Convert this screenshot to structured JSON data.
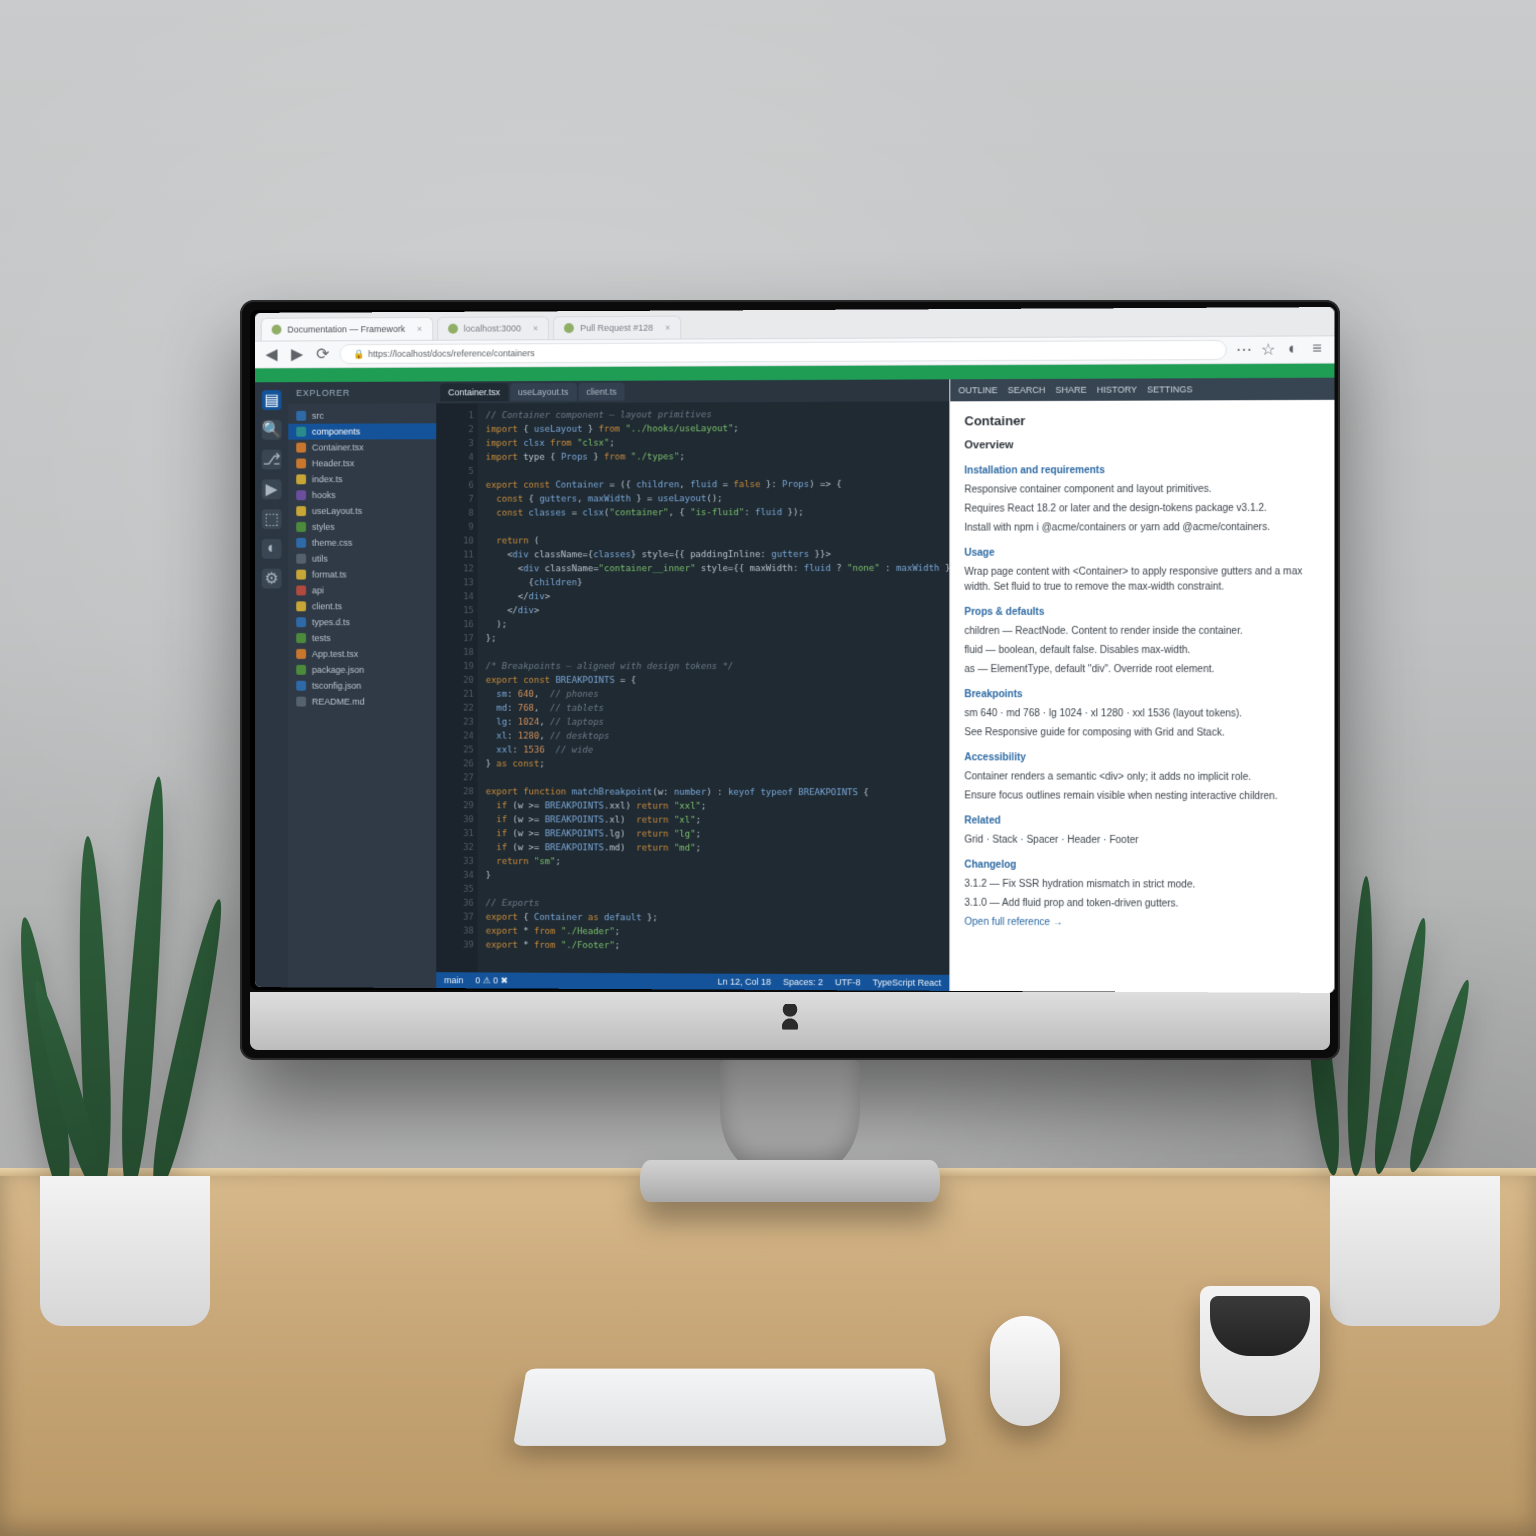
{
  "browser": {
    "tabs": [
      {
        "label": "Documentation — Framework",
        "active": true
      },
      {
        "label": "localhost:3000",
        "active": false
      },
      {
        "label": "Pull Request #128",
        "active": false
      }
    ],
    "url": "https://localhost/docs/reference/containers"
  },
  "activity": {
    "items": [
      "files",
      "search",
      "source-control",
      "debug",
      "extensions",
      "accounts",
      "settings"
    ]
  },
  "sidebar": {
    "title": "EXPLORER",
    "items": [
      {
        "name": "src",
        "color": "c-blue"
      },
      {
        "name": "components",
        "color": "c-teal",
        "sel": true
      },
      {
        "name": "Container.tsx",
        "color": "c-orange"
      },
      {
        "name": "Header.tsx",
        "color": "c-orange"
      },
      {
        "name": "index.ts",
        "color": "c-yellow"
      },
      {
        "name": "hooks",
        "color": "c-purple"
      },
      {
        "name": "useLayout.ts",
        "color": "c-yellow"
      },
      {
        "name": "styles",
        "color": "c-green"
      },
      {
        "name": "theme.css",
        "color": "c-blue"
      },
      {
        "name": "utils",
        "color": "c-gray"
      },
      {
        "name": "format.ts",
        "color": "c-yellow"
      },
      {
        "name": "api",
        "color": "c-red"
      },
      {
        "name": "client.ts",
        "color": "c-yellow"
      },
      {
        "name": "types.d.ts",
        "color": "c-blue"
      },
      {
        "name": "tests",
        "color": "c-green"
      },
      {
        "name": "App.test.tsx",
        "color": "c-orange"
      },
      {
        "name": "package.json",
        "color": "c-green"
      },
      {
        "name": "tsconfig.json",
        "color": "c-blue"
      },
      {
        "name": "README.md",
        "color": "c-gray"
      }
    ]
  },
  "editor": {
    "tabs": [
      {
        "label": "Container.tsx",
        "active": true
      },
      {
        "label": "useLayout.ts",
        "active": false
      },
      {
        "label": "client.ts",
        "active": false
      }
    ],
    "code": [
      [
        [
          "com",
          "// Container component — layout primitives"
        ]
      ],
      [
        [
          "kw",
          "import"
        ],
        [
          "op",
          " { "
        ],
        [
          "fn",
          "useLayout"
        ],
        [
          "op",
          " } "
        ],
        [
          "kw",
          "from"
        ],
        [
          "op",
          " "
        ],
        [
          "str",
          "\"../hooks/useLayout\""
        ],
        [
          "op",
          ";"
        ]
      ],
      [
        [
          "kw",
          "import"
        ],
        [
          "op",
          " "
        ],
        [
          "fn",
          "clsx"
        ],
        [
          "op",
          " "
        ],
        [
          "kw",
          "from"
        ],
        [
          "op",
          " "
        ],
        [
          "str",
          "\"clsx\""
        ],
        [
          "op",
          ";"
        ]
      ],
      [
        [
          "kw",
          "import"
        ],
        [
          "op",
          " type { "
        ],
        [
          "fn",
          "Props"
        ],
        [
          "op",
          " } "
        ],
        [
          "kw",
          "from"
        ],
        [
          "op",
          " "
        ],
        [
          "str",
          "\"./types\""
        ],
        [
          "op",
          ";"
        ]
      ],
      [],
      [
        [
          "kw",
          "export"
        ],
        [
          "op",
          " "
        ],
        [
          "kw",
          "const"
        ],
        [
          "op",
          " "
        ],
        [
          "fn",
          "Container"
        ],
        [
          "op",
          " = ({ "
        ],
        [
          "fn",
          "children"
        ],
        [
          "op",
          ", "
        ],
        [
          "fn",
          "fluid"
        ],
        [
          "op",
          " = "
        ],
        [
          "kw",
          "false"
        ],
        [
          "op",
          " }: "
        ],
        [
          "fn",
          "Props"
        ],
        [
          "op",
          ") => {"
        ]
      ],
      [
        [
          "op",
          "  "
        ],
        [
          "kw",
          "const"
        ],
        [
          "op",
          " { "
        ],
        [
          "fn",
          "gutters"
        ],
        [
          "op",
          ", "
        ],
        [
          "fn",
          "maxWidth"
        ],
        [
          "op",
          " } = "
        ],
        [
          "fn",
          "useLayout"
        ],
        [
          "op",
          "();"
        ]
      ],
      [
        [
          "op",
          "  "
        ],
        [
          "kw",
          "const"
        ],
        [
          "op",
          " "
        ],
        [
          "fn",
          "classes"
        ],
        [
          "op",
          " = "
        ],
        [
          "fn",
          "clsx"
        ],
        [
          "op",
          "("
        ],
        [
          "str",
          "\"container\""
        ],
        [
          "op",
          ", { "
        ],
        [
          "str",
          "\"is-fluid\""
        ],
        [
          "op",
          ": "
        ],
        [
          "fn",
          "fluid"
        ],
        [
          "op",
          " });"
        ]
      ],
      [],
      [
        [
          "op",
          "  "
        ],
        [
          "kw",
          "return"
        ],
        [
          "op",
          " ("
        ]
      ],
      [
        [
          "op",
          "    <"
        ],
        [
          "fn",
          "div"
        ],
        [
          "op",
          " className={"
        ],
        [
          "fn",
          "classes"
        ],
        [
          "op",
          "} style={{ paddingInline: "
        ],
        [
          "fn",
          "gutters"
        ],
        [
          "op",
          " }}>"
        ]
      ],
      [
        [
          "op",
          "      <"
        ],
        [
          "fn",
          "div"
        ],
        [
          "op",
          " className="
        ],
        [
          "str",
          "\"container__inner\""
        ],
        [
          "op",
          " style={{ maxWidth: "
        ],
        [
          "fn",
          "fluid"
        ],
        [
          "op",
          " ? "
        ],
        [
          "str",
          "\"none\""
        ],
        [
          "op",
          " : "
        ],
        [
          "fn",
          "maxWidth"
        ],
        [
          "op",
          " }}>"
        ]
      ],
      [
        [
          "op",
          "        {"
        ],
        [
          "fn",
          "children"
        ],
        [
          "op",
          "}"
        ]
      ],
      [
        [
          "op",
          "      </"
        ],
        [
          "fn",
          "div"
        ],
        [
          "op",
          ">"
        ]
      ],
      [
        [
          "op",
          "    </"
        ],
        [
          "fn",
          "div"
        ],
        [
          "op",
          ">"
        ]
      ],
      [
        [
          "op",
          "  );"
        ]
      ],
      [
        [
          "op",
          "};"
        ]
      ],
      [],
      [
        [
          "com",
          "/* Breakpoints — aligned with design tokens */"
        ]
      ],
      [
        [
          "kw",
          "export"
        ],
        [
          "op",
          " "
        ],
        [
          "kw",
          "const"
        ],
        [
          "op",
          " "
        ],
        [
          "fn",
          "BREAKPOINTS"
        ],
        [
          "op",
          " = {"
        ]
      ],
      [
        [
          "op",
          "  "
        ],
        [
          "fn",
          "sm"
        ],
        [
          "op",
          ": "
        ],
        [
          "num",
          "640"
        ],
        [
          "op",
          ",  "
        ],
        [
          "com",
          "// phones"
        ]
      ],
      [
        [
          "op",
          "  "
        ],
        [
          "fn",
          "md"
        ],
        [
          "op",
          ": "
        ],
        [
          "num",
          "768"
        ],
        [
          "op",
          ",  "
        ],
        [
          "com",
          "// tablets"
        ]
      ],
      [
        [
          "op",
          "  "
        ],
        [
          "fn",
          "lg"
        ],
        [
          "op",
          ": "
        ],
        [
          "num",
          "1024"
        ],
        [
          "op",
          ", "
        ],
        [
          "com",
          "// laptops"
        ]
      ],
      [
        [
          "op",
          "  "
        ],
        [
          "fn",
          "xl"
        ],
        [
          "op",
          ": "
        ],
        [
          "num",
          "1280"
        ],
        [
          "op",
          ", "
        ],
        [
          "com",
          "// desktops"
        ]
      ],
      [
        [
          "op",
          "  "
        ],
        [
          "fn",
          "xxl"
        ],
        [
          "op",
          ": "
        ],
        [
          "num",
          "1536"
        ],
        [
          "op",
          "  "
        ],
        [
          "com",
          "// wide"
        ]
      ],
      [
        [
          "op",
          "} "
        ],
        [
          "kw",
          "as const"
        ],
        [
          "op",
          ";"
        ]
      ],
      [],
      [
        [
          "kw",
          "export"
        ],
        [
          "op",
          " "
        ],
        [
          "kw",
          "function"
        ],
        [
          "op",
          " "
        ],
        [
          "fn",
          "matchBreakpoint"
        ],
        [
          "op",
          "(w: "
        ],
        [
          "fn",
          "number"
        ],
        [
          "op",
          ") : "
        ],
        [
          "fn",
          "keyof typeof"
        ],
        [
          "op",
          " "
        ],
        [
          "fn",
          "BREAKPOINTS"
        ],
        [
          "op",
          " {"
        ]
      ],
      [
        [
          "op",
          "  "
        ],
        [
          "kw",
          "if"
        ],
        [
          "op",
          " (w >= "
        ],
        [
          "fn",
          "BREAKPOINTS"
        ],
        [
          "op",
          ".xxl) "
        ],
        [
          "kw",
          "return"
        ],
        [
          "op",
          " "
        ],
        [
          "str",
          "\"xxl\""
        ],
        [
          "op",
          ";"
        ]
      ],
      [
        [
          "op",
          "  "
        ],
        [
          "kw",
          "if"
        ],
        [
          "op",
          " (w >= "
        ],
        [
          "fn",
          "BREAKPOINTS"
        ],
        [
          "op",
          ".xl)  "
        ],
        [
          "kw",
          "return"
        ],
        [
          "op",
          " "
        ],
        [
          "str",
          "\"xl\""
        ],
        [
          "op",
          ";"
        ]
      ],
      [
        [
          "op",
          "  "
        ],
        [
          "kw",
          "if"
        ],
        [
          "op",
          " (w >= "
        ],
        [
          "fn",
          "BREAKPOINTS"
        ],
        [
          "op",
          ".lg)  "
        ],
        [
          "kw",
          "return"
        ],
        [
          "op",
          " "
        ],
        [
          "str",
          "\"lg\""
        ],
        [
          "op",
          ";"
        ]
      ],
      [
        [
          "op",
          "  "
        ],
        [
          "kw",
          "if"
        ],
        [
          "op",
          " (w >= "
        ],
        [
          "fn",
          "BREAKPOINTS"
        ],
        [
          "op",
          ".md)  "
        ],
        [
          "kw",
          "return"
        ],
        [
          "op",
          " "
        ],
        [
          "str",
          "\"md\""
        ],
        [
          "op",
          ";"
        ]
      ],
      [
        [
          "op",
          "  "
        ],
        [
          "kw",
          "return"
        ],
        [
          "op",
          " "
        ],
        [
          "str",
          "\"sm\""
        ],
        [
          "op",
          ";"
        ]
      ],
      [
        [
          "op",
          "}"
        ]
      ],
      [],
      [
        [
          "com",
          "// Exports"
        ]
      ],
      [
        [
          "kw",
          "export"
        ],
        [
          "op",
          " { "
        ],
        [
          "fn",
          "Container"
        ],
        [
          "op",
          " "
        ],
        [
          "kw",
          "as"
        ],
        [
          "op",
          " "
        ],
        [
          "fn",
          "default"
        ],
        [
          "op",
          " };"
        ]
      ],
      [
        [
          "kw",
          "export"
        ],
        [
          "op",
          " * "
        ],
        [
          "kw",
          "from"
        ],
        [
          "op",
          " "
        ],
        [
          "str",
          "\"./Header\""
        ],
        [
          "op",
          ";"
        ]
      ],
      [
        [
          "kw",
          "export"
        ],
        [
          "op",
          " * "
        ],
        [
          "kw",
          "from"
        ],
        [
          "op",
          " "
        ],
        [
          "str",
          "\"./Footer\""
        ],
        [
          "op",
          ";"
        ]
      ]
    ]
  },
  "doc": {
    "toolbar": [
      "OUTLINE",
      "SEARCH",
      "SHARE",
      "HISTORY",
      "SETTINGS"
    ],
    "title": "Container",
    "subtitle": "Overview",
    "lead": "Responsive container component and layout primitives.",
    "section1": "Installation and requirements",
    "p1": "Requires React 18.2 or later and the design-tokens package v3.1.2.",
    "p2": "Install with npm i @acme/containers or yarn add @acme/containers.",
    "h_usage": "Usage",
    "p3": "Wrap page content with <Container> to apply responsive gutters and a max width. Set fluid to true to remove the max-width constraint.",
    "h_props": "Props & defaults",
    "p4": "children — ReactNode. Content to render inside the container.",
    "p5": "fluid — boolean, default false. Disables max-width.",
    "p6": "as — ElementType, default \"div\". Override root element.",
    "h_bp": "Breakpoints",
    "p7": "sm 640 · md 768 · lg 1024 · xl 1280 · xxl 1536 (layout tokens).",
    "p8": "See Responsive guide for composing with Grid and Stack.",
    "h_acc": "Accessibility",
    "p9": "Container renders a semantic <div> only; it adds no implicit role.",
    "p10": "Ensure focus outlines remain visible when nesting interactive children.",
    "h_rel": "Related",
    "p11": "Grid · Stack · Spacer · Header · Footer",
    "h_cl": "Changelog",
    "p12": "3.1.2 — Fix SSR hydration mismatch in strict mode.",
    "p13": "3.1.0 — Add fluid prop and token-driven gutters.",
    "link1": "Open full reference →"
  },
  "status": {
    "branch": "main",
    "errors": "0 ⚠ 0 ✖",
    "pos": "Ln 12, Col 18",
    "enc": "UTF-8",
    "lang": "TypeScript React",
    "spaces": "Spaces: 2"
  }
}
